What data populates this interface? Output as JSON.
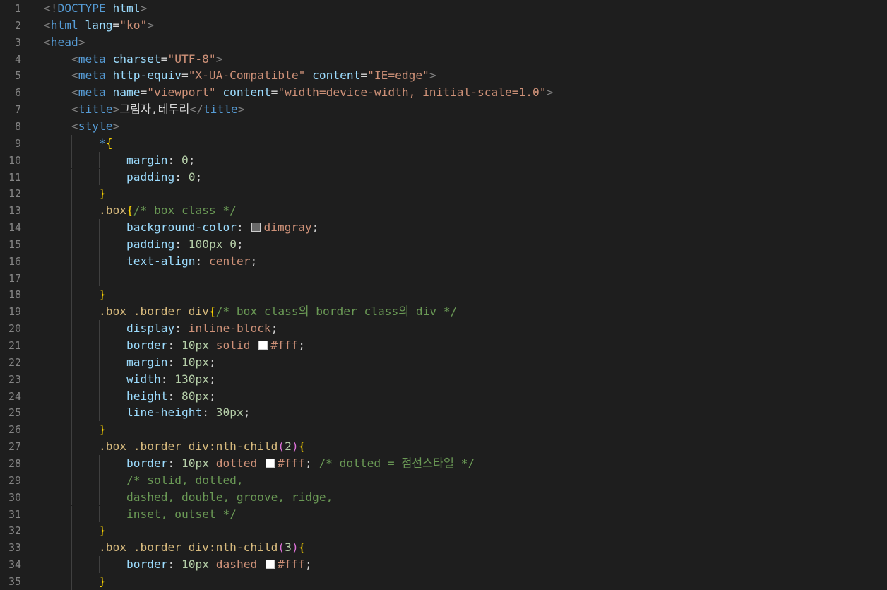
{
  "editor": {
    "language": "html",
    "theme_colors": {
      "background": "#1e1e1e",
      "line_number": "#858585",
      "punct": "#808080",
      "tag": "#569cd6",
      "attr": "#9cdcfe",
      "string": "#ce9178",
      "selector": "#d7ba7d",
      "comment": "#6a9955",
      "number": "#b5cea8",
      "brace": "#ffd700",
      "brace2": "#da70d6",
      "text": "#d4d4d4"
    },
    "lines": [
      {
        "n": "1",
        "indent": 0,
        "tokens": [
          [
            "p",
            "<!"
          ],
          [
            "t",
            "DOCTYPE"
          ],
          [
            "a",
            " html"
          ],
          [
            "p",
            ">"
          ]
        ]
      },
      {
        "n": "2",
        "indent": 0,
        "tokens": [
          [
            "p",
            "<"
          ],
          [
            "t",
            "html"
          ],
          [
            "a",
            " lang"
          ],
          [
            "x",
            "="
          ],
          [
            "s",
            "\"ko\""
          ],
          [
            "p",
            ">"
          ]
        ]
      },
      {
        "n": "3",
        "indent": 0,
        "tokens": [
          [
            "p",
            "<"
          ],
          [
            "t",
            "head"
          ],
          [
            "p",
            ">"
          ]
        ]
      },
      {
        "n": "4",
        "indent": 1,
        "tokens": [
          [
            "p",
            "<"
          ],
          [
            "t",
            "meta"
          ],
          [
            "a",
            " charset"
          ],
          [
            "x",
            "="
          ],
          [
            "s",
            "\"UTF-8\""
          ],
          [
            "p",
            ">"
          ]
        ]
      },
      {
        "n": "5",
        "indent": 1,
        "tokens": [
          [
            "p",
            "<"
          ],
          [
            "t",
            "meta"
          ],
          [
            "a",
            " http-equiv"
          ],
          [
            "x",
            "="
          ],
          [
            "s",
            "\"X-UA-Compatible\""
          ],
          [
            "a",
            " content"
          ],
          [
            "x",
            "="
          ],
          [
            "s",
            "\"IE=edge\""
          ],
          [
            "p",
            ">"
          ]
        ]
      },
      {
        "n": "6",
        "indent": 1,
        "tokens": [
          [
            "p",
            "<"
          ],
          [
            "t",
            "meta"
          ],
          [
            "a",
            " name"
          ],
          [
            "x",
            "="
          ],
          [
            "s",
            "\"viewport\""
          ],
          [
            "a",
            " content"
          ],
          [
            "x",
            "="
          ],
          [
            "s",
            "\"width=device-width, initial-scale=1.0\""
          ],
          [
            "p",
            ">"
          ]
        ]
      },
      {
        "n": "7",
        "indent": 1,
        "tokens": [
          [
            "p",
            "<"
          ],
          [
            "t",
            "title"
          ],
          [
            "p",
            ">"
          ],
          [
            "x",
            "그림자,테두리"
          ],
          [
            "p",
            "</"
          ],
          [
            "t",
            "title"
          ],
          [
            "p",
            ">"
          ]
        ]
      },
      {
        "n": "8",
        "indent": 1,
        "tokens": [
          [
            "p",
            "<"
          ],
          [
            "t",
            "style"
          ],
          [
            "p",
            ">"
          ]
        ]
      },
      {
        "n": "9",
        "indent": 2,
        "tokens": [
          [
            "t",
            "*"
          ],
          [
            "b",
            "{"
          ]
        ]
      },
      {
        "n": "10",
        "indent": 3,
        "tokens": [
          [
            "a",
            "margin"
          ],
          [
            "x",
            ": "
          ],
          [
            "num",
            "0"
          ],
          [
            "x",
            ";"
          ]
        ]
      },
      {
        "n": "11",
        "indent": 3,
        "tokens": [
          [
            "a",
            "padding"
          ],
          [
            "x",
            ": "
          ],
          [
            "num",
            "0"
          ],
          [
            "x",
            ";"
          ]
        ]
      },
      {
        "n": "12",
        "indent": 2,
        "tokens": [
          [
            "b",
            "}"
          ]
        ]
      },
      {
        "n": "13",
        "indent": 2,
        "tokens": [
          [
            "sel",
            ".box"
          ],
          [
            "b",
            "{"
          ],
          [
            "c",
            "/* box class */"
          ]
        ]
      },
      {
        "n": "14",
        "indent": 3,
        "tokens": [
          [
            "a",
            "background-color"
          ],
          [
            "x",
            ": "
          ],
          [
            "sw",
            "#696969"
          ],
          [
            "s",
            "dimgray"
          ],
          [
            "x",
            ";"
          ]
        ]
      },
      {
        "n": "15",
        "indent": 3,
        "tokens": [
          [
            "a",
            "padding"
          ],
          [
            "x",
            ": "
          ],
          [
            "num",
            "100px 0"
          ],
          [
            "x",
            ";"
          ]
        ]
      },
      {
        "n": "16",
        "indent": 3,
        "tokens": [
          [
            "a",
            "text-align"
          ],
          [
            "x",
            ": "
          ],
          [
            "s",
            "center"
          ],
          [
            "x",
            ";"
          ]
        ]
      },
      {
        "n": "17",
        "indent": 3,
        "tokens": []
      },
      {
        "n": "18",
        "indent": 2,
        "tokens": [
          [
            "b",
            "}"
          ]
        ]
      },
      {
        "n": "19",
        "indent": 2,
        "tokens": [
          [
            "sel",
            ".box .border div"
          ],
          [
            "b",
            "{"
          ],
          [
            "c",
            "/* box class의 border class의 div */"
          ]
        ]
      },
      {
        "n": "20",
        "indent": 3,
        "tokens": [
          [
            "a",
            "display"
          ],
          [
            "x",
            ": "
          ],
          [
            "s",
            "inline-block"
          ],
          [
            "x",
            ";"
          ]
        ]
      },
      {
        "n": "21",
        "indent": 3,
        "tokens": [
          [
            "a",
            "border"
          ],
          [
            "x",
            ": "
          ],
          [
            "num",
            "10px"
          ],
          [
            "x",
            " "
          ],
          [
            "s",
            "solid"
          ],
          [
            "x",
            " "
          ],
          [
            "sw",
            "#ffffff"
          ],
          [
            "s",
            "#fff"
          ],
          [
            "x",
            ";"
          ]
        ]
      },
      {
        "n": "22",
        "indent": 3,
        "tokens": [
          [
            "a",
            "margin"
          ],
          [
            "x",
            ": "
          ],
          [
            "num",
            "10px"
          ],
          [
            "x",
            ";"
          ]
        ]
      },
      {
        "n": "23",
        "indent": 3,
        "tokens": [
          [
            "a",
            "width"
          ],
          [
            "x",
            ": "
          ],
          [
            "num",
            "130px"
          ],
          [
            "x",
            ";"
          ]
        ]
      },
      {
        "n": "24",
        "indent": 3,
        "tokens": [
          [
            "a",
            "height"
          ],
          [
            "x",
            ": "
          ],
          [
            "num",
            "80px"
          ],
          [
            "x",
            ";"
          ]
        ]
      },
      {
        "n": "25",
        "indent": 3,
        "tokens": [
          [
            "a",
            "line-height"
          ],
          [
            "x",
            ": "
          ],
          [
            "num",
            "30px"
          ],
          [
            "x",
            ";"
          ]
        ]
      },
      {
        "n": "26",
        "indent": 2,
        "tokens": [
          [
            "b",
            "}"
          ]
        ]
      },
      {
        "n": "27",
        "indent": 2,
        "tokens": [
          [
            "sel",
            ".box .border div:nth-child"
          ],
          [
            "b2",
            "("
          ],
          [
            "num",
            "2"
          ],
          [
            "b2",
            ")"
          ],
          [
            "b",
            "{"
          ]
        ]
      },
      {
        "n": "28",
        "indent": 3,
        "tokens": [
          [
            "a",
            "border"
          ],
          [
            "x",
            ": "
          ],
          [
            "num",
            "10px"
          ],
          [
            "x",
            " "
          ],
          [
            "s",
            "dotted"
          ],
          [
            "x",
            " "
          ],
          [
            "sw",
            "#ffffff"
          ],
          [
            "s",
            "#fff"
          ],
          [
            "x",
            "; "
          ],
          [
            "c",
            "/* dotted = 점선스타일 */"
          ]
        ]
      },
      {
        "n": "29",
        "indent": 3,
        "tokens": [
          [
            "c",
            "/* solid, dotted,"
          ]
        ]
      },
      {
        "n": "30",
        "indent": 3,
        "tokens": [
          [
            "c",
            "dashed, double, groove, ridge,"
          ]
        ]
      },
      {
        "n": "31",
        "indent": 3,
        "tokens": [
          [
            "c",
            "inset, outset */"
          ]
        ]
      },
      {
        "n": "32",
        "indent": 2,
        "tokens": [
          [
            "b",
            "}"
          ]
        ]
      },
      {
        "n": "33",
        "indent": 2,
        "tokens": [
          [
            "sel",
            ".box .border div:nth-child"
          ],
          [
            "b2",
            "("
          ],
          [
            "num",
            "3"
          ],
          [
            "b2",
            ")"
          ],
          [
            "b",
            "{"
          ]
        ]
      },
      {
        "n": "34",
        "indent": 3,
        "tokens": [
          [
            "a",
            "border"
          ],
          [
            "x",
            ": "
          ],
          [
            "num",
            "10px"
          ],
          [
            "x",
            " "
          ],
          [
            "s",
            "dashed"
          ],
          [
            "x",
            " "
          ],
          [
            "sw",
            "#ffffff"
          ],
          [
            "s",
            "#fff"
          ],
          [
            "x",
            ";"
          ]
        ]
      },
      {
        "n": "35",
        "indent": 2,
        "tokens": [
          [
            "b",
            "}"
          ]
        ]
      }
    ]
  }
}
